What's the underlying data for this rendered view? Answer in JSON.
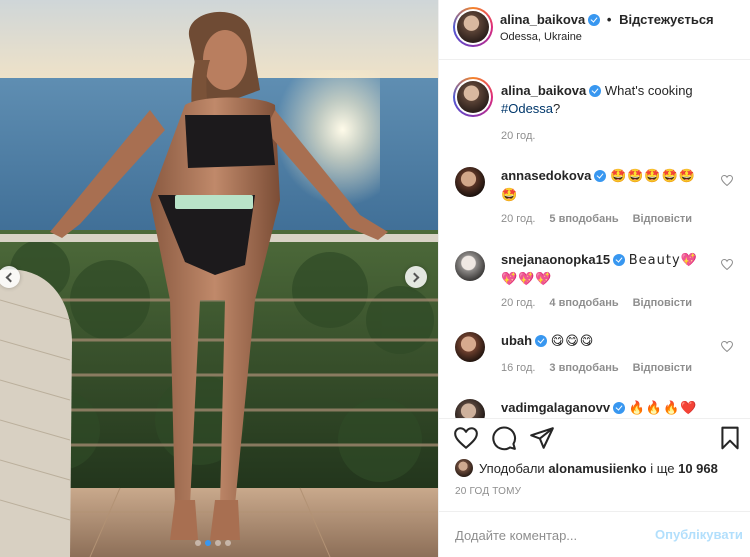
{
  "header": {
    "username": "alina_baikova",
    "separator": "•",
    "follow_status": "Відстежується",
    "location": "Odessa, Ukraine"
  },
  "caption": {
    "username": "alina_baikova",
    "text": "What's cooking",
    "hashtag": "#Odessa",
    "suffix": "?",
    "time": "20 год."
  },
  "comments": [
    {
      "username": "annasedokova",
      "text": "🤩🤩🤩🤩🤩🤩",
      "time": "20 год.",
      "likes": "5 вподобань",
      "reply": "Відповісти"
    },
    {
      "username": "snejanaonopka15",
      "text": "Beauty💖💖💖💖",
      "time": "20 год.",
      "likes": "4 вподобань",
      "reply": "Відповісти"
    },
    {
      "username": "ubah",
      "text": "😋😋😋",
      "time": "16 год.",
      "likes": "3 вподобань",
      "reply": "Відповісти"
    },
    {
      "username": "vadimgalaganovv",
      "text": "🔥🔥🔥❤️"
    }
  ],
  "actions": {
    "like": "heart-icon",
    "comment": "comment-icon",
    "share": "share-icon",
    "save": "bookmark-icon"
  },
  "liked_by": {
    "prefix": "Уподобали",
    "user": "alonamusiienko",
    "middle": "і ще",
    "count": "10 968"
  },
  "timestamp": "20 ГОД ТОМУ",
  "add_comment": {
    "placeholder": "Додайте коментар...",
    "publish_label": "Опублікувати"
  },
  "carousel": {
    "total": 4,
    "active": 1
  },
  "colors": {
    "link": "#00376b",
    "verified": "#3897f0",
    "publish_disabled": "#b2dffc",
    "muted": "#8e8e8e"
  }
}
